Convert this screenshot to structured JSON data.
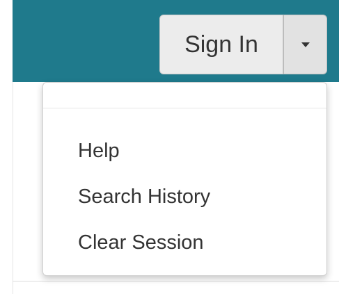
{
  "header": {
    "background_color": "#1f7a8c",
    "sign_in_label": "Sign In",
    "toggle_icon": "caret-down-icon"
  },
  "dropdown": {
    "items": [
      {
        "label": "Help"
      },
      {
        "label": "Search History"
      },
      {
        "label": "Clear Session"
      }
    ]
  }
}
